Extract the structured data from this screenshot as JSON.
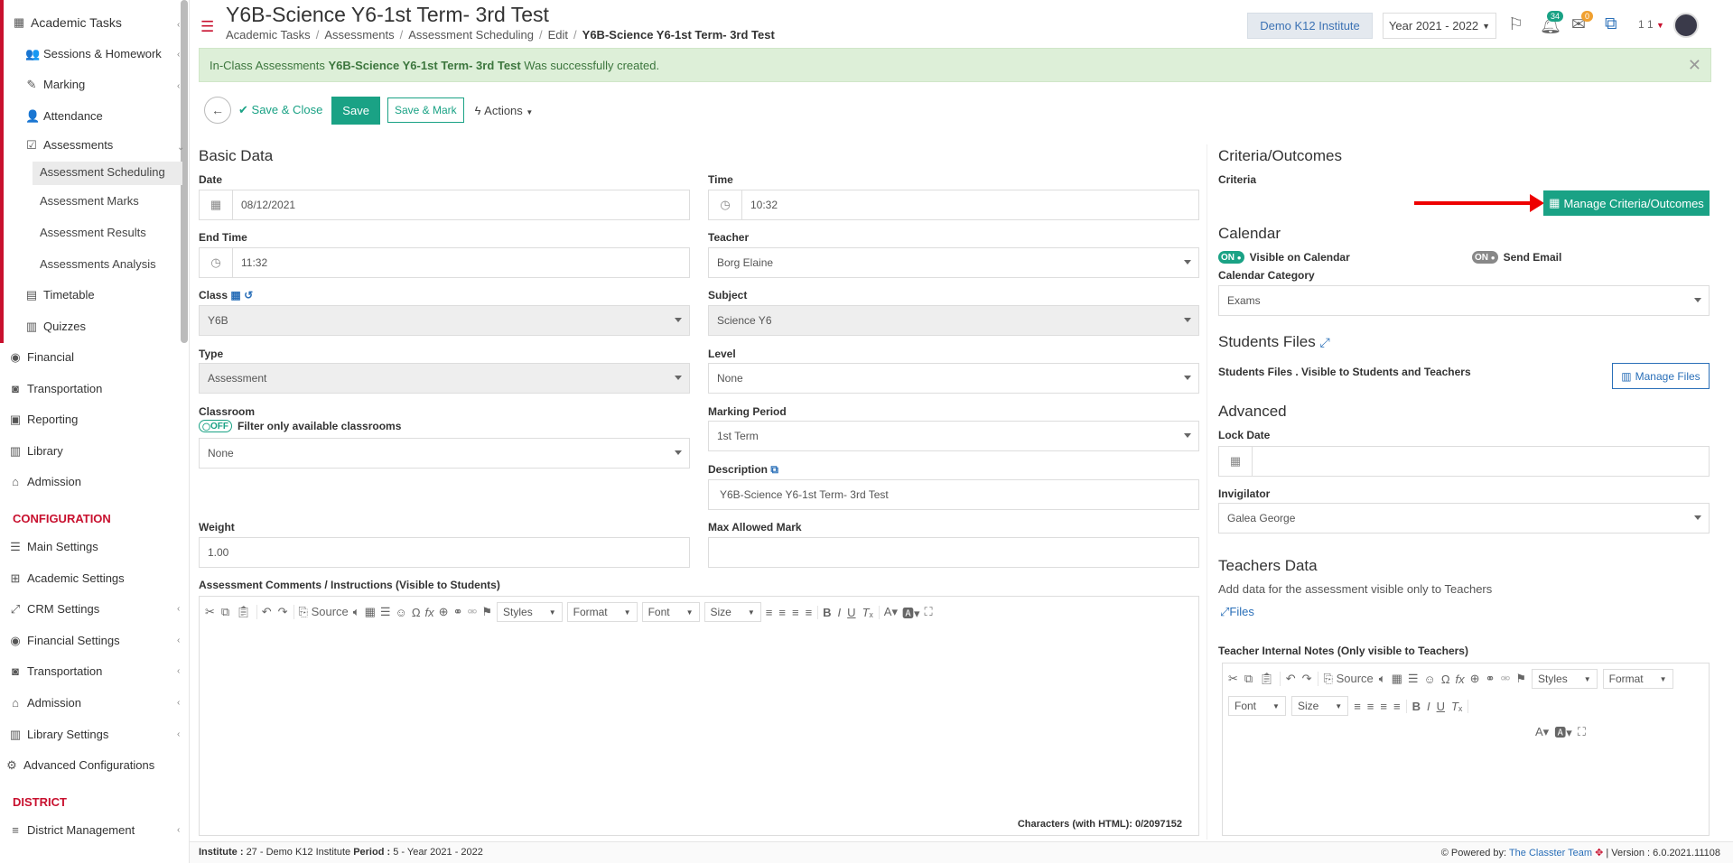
{
  "sidebar": {
    "items": [
      {
        "label": "Academic Tasks",
        "icon": "grid-icon"
      },
      {
        "label": "Sessions & Homework",
        "icon": "users-icon"
      },
      {
        "label": "Marking",
        "icon": "edit-icon"
      },
      {
        "label": "Attendance",
        "icon": "user-icon"
      },
      {
        "label": "Assessments",
        "icon": "check-square-icon"
      },
      {
        "label": "Assessment Scheduling"
      },
      {
        "label": "Assessment Marks"
      },
      {
        "label": "Assessment Results"
      },
      {
        "label": "Assessments Analysis"
      },
      {
        "label": "Timetable",
        "icon": "calendar-icon"
      },
      {
        "label": "Quizzes",
        "icon": "file-icon"
      },
      {
        "label": "Financial",
        "icon": "coins-icon"
      },
      {
        "label": "Transportation",
        "icon": "bus-icon"
      },
      {
        "label": "Reporting",
        "icon": "print-icon"
      },
      {
        "label": "Library",
        "icon": "books-icon"
      },
      {
        "label": "Admission",
        "icon": "building-icon"
      }
    ],
    "config_header": "CONFIGURATION",
    "config_items": [
      {
        "label": "Main Settings"
      },
      {
        "label": "Academic Settings"
      },
      {
        "label": "CRM Settings"
      },
      {
        "label": "Financial Settings"
      },
      {
        "label": "Transportation"
      },
      {
        "label": "Admission"
      },
      {
        "label": "Library Settings"
      },
      {
        "label": "Advanced Configurations"
      }
    ],
    "district_header": "DISTRICT",
    "district_items": [
      {
        "label": "District Management"
      }
    ]
  },
  "header": {
    "title": "Y6B-Science Y6-1st Term- 3rd Test",
    "breadcrumbs": [
      "Academic Tasks",
      "Assessments",
      "Assessment Scheduling",
      "Edit"
    ],
    "breadcrumb_current": "Y6B-Science Y6-1st Term- 3rd Test",
    "institute": "Demo K12 Institute",
    "year": "Year 2021 - 2022",
    "notif_count": "34",
    "mail_count": "0",
    "user": "1 1"
  },
  "alert": {
    "prefix": "In-Class Assessments",
    "name": "Y6B-Science Y6-1st Term- 3rd Test",
    "suffix": "Was successfully created."
  },
  "toolbar": {
    "save_close": "Save & Close",
    "save": "Save",
    "save_mark": "Save & Mark",
    "actions": "Actions"
  },
  "basic": {
    "title": "Basic Data",
    "date_label": "Date",
    "date": "08/12/2021",
    "time_label": "Time",
    "time": "10:32",
    "end_time_label": "End Time",
    "end_time": "11:32",
    "teacher_label": "Teacher",
    "teacher": "Borg Elaine",
    "class_label": "Class",
    "class": "Y6B",
    "subject_label": "Subject",
    "subject": "Science Y6",
    "type_label": "Type",
    "type": "Assessment",
    "level_label": "Level",
    "level": "None",
    "classroom_label": "Classroom",
    "classroom_toggle": "OFF",
    "classroom_filter": "Filter only available classrooms",
    "classroom": "None",
    "marking_period_label": "Marking Period",
    "marking_period": "1st Term",
    "description_label": "Description",
    "description": "Y6B-Science Y6-1st Term- 3rd Test",
    "weight_label": "Weight",
    "weight": "1.00",
    "max_mark_label": "Max Allowed Mark",
    "max_mark": "",
    "comments_label": "Assessment Comments / Instructions (Visible to Students)",
    "char_count": "Characters (with HTML): 0/2097152"
  },
  "editor": {
    "source": "Source",
    "styles": "Styles",
    "format": "Format",
    "font": "Font",
    "size": "Size"
  },
  "right": {
    "criteria_title": "Criteria/Outcomes",
    "criteria_label": "Criteria",
    "manage_criteria": "Manage Criteria/Outcomes",
    "calendar_title": "Calendar",
    "toggle_on": "ON",
    "visible_calendar": "Visible on Calendar",
    "send_email": "Send Email",
    "calendar_category_label": "Calendar Category",
    "calendar_category": "Exams",
    "students_files_title": "Students Files",
    "students_files_text": "Students Files . Visible to Students and Teachers",
    "manage_files": "Manage Files",
    "advanced_title": "Advanced",
    "lock_date_label": "Lock Date",
    "invigilator_label": "Invigilator",
    "invigilator": "Galea George",
    "teachers_data_title": "Teachers Data",
    "teachers_data_text": "Add data for the assessment visible only to Teachers",
    "files_link": "Files",
    "teacher_notes_label": "Teacher Internal Notes (Only visible to Teachers)"
  },
  "footer": {
    "institute_label": "Institute :",
    "institute": "27 - Demo K12 Institute",
    "period_label": "Period :",
    "period": "5 - Year 2021 - 2022",
    "powered": "Powered by:",
    "team": "The Classter Team",
    "version": "| Version : 6.0.2021.11108"
  },
  "colors": {
    "accent": "#1aa285",
    "brand_red": "#c8102e",
    "link": "#2a6fb8"
  }
}
